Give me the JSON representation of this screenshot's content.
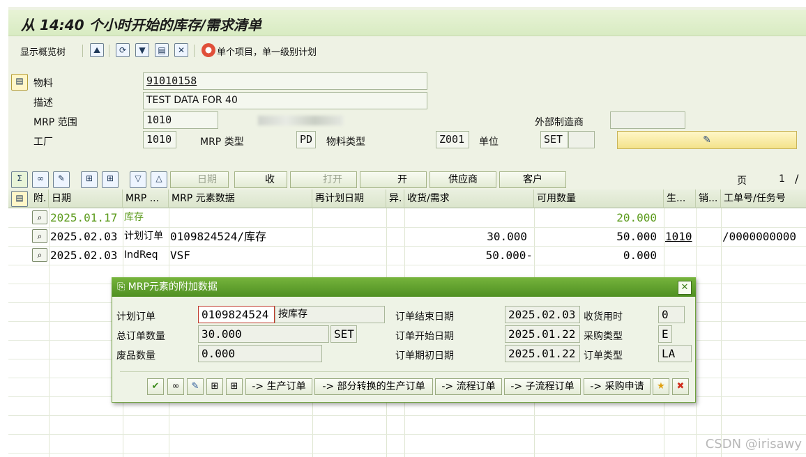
{
  "title": "从 14:40 个小时开始的库存/需求清单",
  "toolbar": {
    "overview_tree": "显示概览树",
    "single_item": "单个项目，单一级别计划"
  },
  "header": {
    "material_label": "物料",
    "material_value": "91010158",
    "desc_label": "描述",
    "desc_value": "TEST DATA FOR 40",
    "mrp_area_label": "MRP 范围",
    "mrp_area_value": "1010",
    "plant_label": "工厂",
    "plant_value": "1010",
    "mrp_type_label": "MRP 类型",
    "mrp_type_value": "PD",
    "mat_type_label": "物料类型",
    "mat_type_value": "Z001",
    "unit_label": "单位",
    "unit_value": "SET",
    "ext_mfr_label": "外部制造商"
  },
  "grid_toolbar": {
    "period": "日期",
    "receipt": "收",
    "open": "打开",
    "open2": "开",
    "vendor": "供应商",
    "customer": "客户",
    "page_label": "页",
    "page_num": "1",
    "page_sep": "/"
  },
  "columns": [
    "附.",
    "日期",
    "MRP ...",
    "MRP 元素数据",
    "再计划日期",
    "异.",
    "收货/需求",
    "可用数量",
    "生...",
    "销...",
    "工单号/任务号"
  ],
  "rows": [
    {
      "date": "2025.01.17",
      "element": "库存",
      "data": "",
      "qty": "",
      "avail": "20.000",
      "plant": "",
      "order": ""
    },
    {
      "date": "2025.02.03",
      "element": "计划订单",
      "data": "0109824524/库存",
      "qty": "30.000",
      "avail": "50.000",
      "plant": "1010",
      "order": "/0000000000"
    },
    {
      "date": "2025.02.03",
      "element": "IndReq",
      "data": "VSF",
      "qty": "50.000-",
      "avail": "0.000",
      "plant": "",
      "order": ""
    }
  ],
  "dialog": {
    "title": "MRP元素的附加数据",
    "planned_order_label": "计划订单",
    "planned_order_value": "0109824524",
    "planned_order_suffix": "按库存",
    "total_qty_label": "总订单数量",
    "total_qty_value": "30.000",
    "total_qty_unit": "SET",
    "scrap_label": "废品数量",
    "scrap_value": "0.000",
    "end_date_label": "订单结束日期",
    "end_date_value": "2025.02.03",
    "start_date_label": "订单开始日期",
    "start_date_value": "2025.01.22",
    "open_date_label": "订单期初日期",
    "open_date_value": "2025.01.22",
    "gr_time_label": "收货用时",
    "gr_time_value": "0",
    "proc_type_label": "采购类型",
    "proc_type_value": "E",
    "order_type_label": "订单类型",
    "order_type_value": "LA",
    "btn_prod_order": "-> 生产订单",
    "btn_partial_prod": "-> 部分转换的生产订单",
    "btn_process": "-> 流程订单",
    "btn_subprocess": "-> 子流程订单",
    "btn_purch_req": "-> 采购申请"
  },
  "watermark": "CSDN @irisawy"
}
